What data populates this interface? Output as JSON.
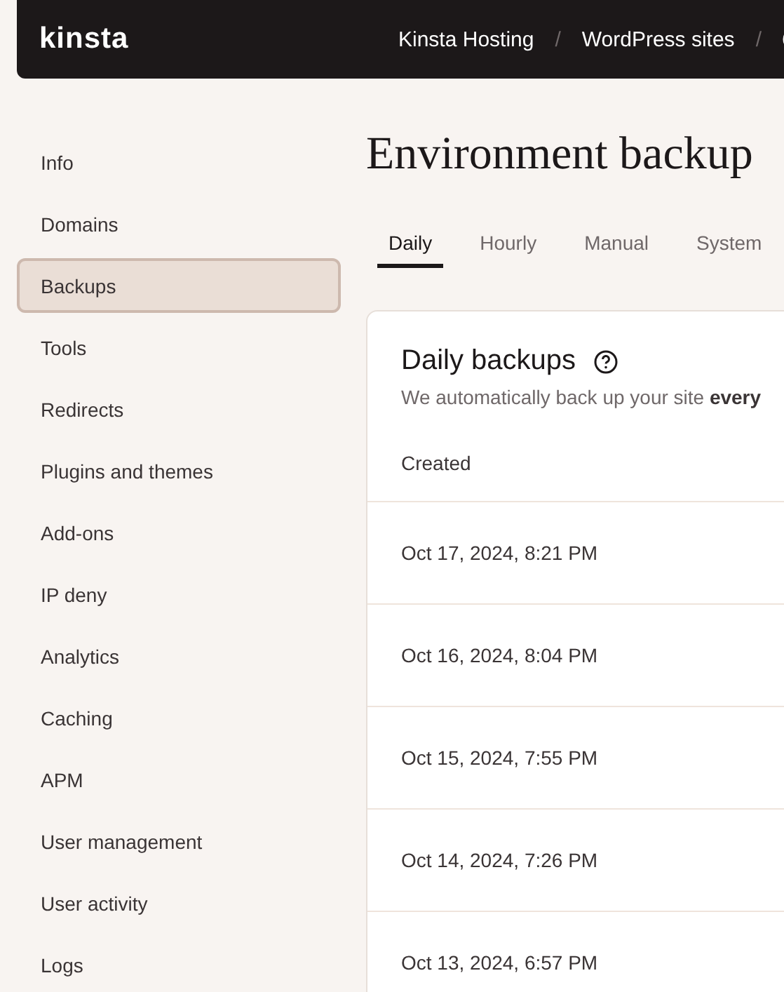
{
  "header": {
    "logo": "kinsta",
    "breadcrumbs": [
      "Kinsta Hosting",
      "WordPress sites"
    ],
    "separator": "/"
  },
  "sidebar": {
    "items": [
      {
        "label": "Info",
        "selected": false
      },
      {
        "label": "Domains",
        "selected": false
      },
      {
        "label": "Backups",
        "selected": true
      },
      {
        "label": "Tools",
        "selected": false
      },
      {
        "label": "Redirects",
        "selected": false
      },
      {
        "label": "Plugins and themes",
        "selected": false
      },
      {
        "label": "Add-ons",
        "selected": false
      },
      {
        "label": "IP deny",
        "selected": false
      },
      {
        "label": "Analytics",
        "selected": false
      },
      {
        "label": "Caching",
        "selected": false
      },
      {
        "label": "APM",
        "selected": false
      },
      {
        "label": "User management",
        "selected": false
      },
      {
        "label": "User activity",
        "selected": false
      },
      {
        "label": "Logs",
        "selected": false
      }
    ]
  },
  "page": {
    "title": "Environment backup",
    "tabs": [
      {
        "label": "Daily",
        "selected": true
      },
      {
        "label": "Hourly",
        "selected": false
      },
      {
        "label": "Manual",
        "selected": false
      },
      {
        "label": "System",
        "selected": false
      }
    ],
    "card": {
      "title": "Daily backups",
      "description": "We automatically back up your site **every**",
      "table": {
        "columns": [
          "Created"
        ],
        "rows": [
          [
            "Oct 17, 2024, 8:21 PM"
          ],
          [
            "Oct 16, 2024, 8:04 PM"
          ],
          [
            "Oct 15, 2024, 7:55 PM"
          ],
          [
            "Oct 14, 2024, 7:26 PM"
          ],
          [
            "Oct 13, 2024, 6:57 PM"
          ]
        ]
      }
    }
  }
}
